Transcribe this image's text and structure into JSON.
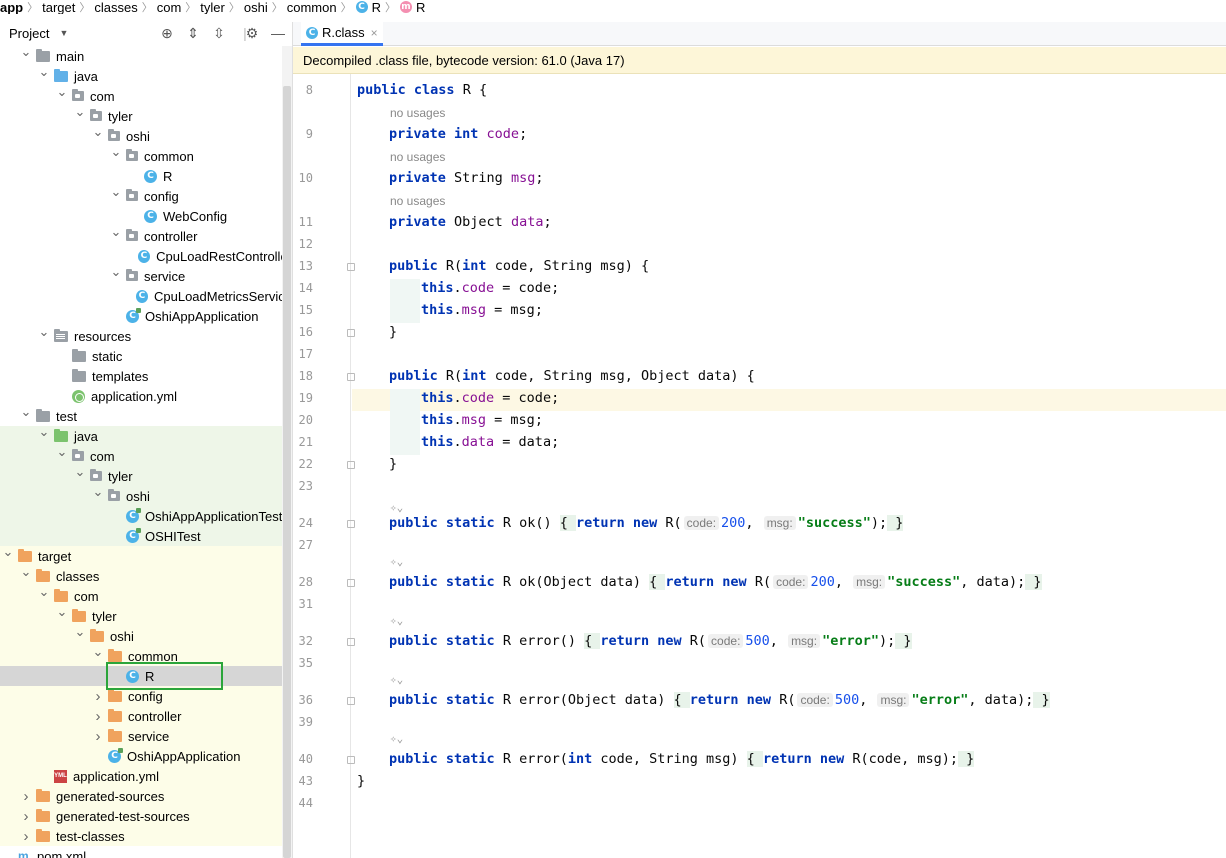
{
  "breadcrumb": {
    "items": [
      "app",
      "target",
      "classes",
      "com",
      "tyler",
      "oshi",
      "common",
      "R",
      "R"
    ]
  },
  "project_panel": {
    "title": "Project",
    "dropdown_icon": "caret-down-icon"
  },
  "tree": [
    {
      "label": "main",
      "type": "folder-gray",
      "depth": 2,
      "arrow": "down"
    },
    {
      "label": "java",
      "type": "folder-blue",
      "depth": 3,
      "arrow": "down"
    },
    {
      "label": "com",
      "type": "package",
      "depth": 4,
      "arrow": "down"
    },
    {
      "label": "tyler",
      "type": "package",
      "depth": 5,
      "arrow": "down"
    },
    {
      "label": "oshi",
      "type": "package",
      "depth": 6,
      "arrow": "down"
    },
    {
      "label": "common",
      "type": "package",
      "depth": 7,
      "arrow": "down"
    },
    {
      "label": "R",
      "type": "class",
      "depth": 8,
      "arrow": ""
    },
    {
      "label": "config",
      "type": "package",
      "depth": 7,
      "arrow": "down"
    },
    {
      "label": "WebConfig",
      "type": "class",
      "depth": 8,
      "arrow": ""
    },
    {
      "label": "controller",
      "type": "package",
      "depth": 7,
      "arrow": "down"
    },
    {
      "label": "CpuLoadRestController",
      "type": "class",
      "depth": 8,
      "arrow": ""
    },
    {
      "label": "service",
      "type": "package",
      "depth": 7,
      "arrow": "down"
    },
    {
      "label": "CpuLoadMetricsService",
      "type": "class",
      "depth": 8,
      "arrow": ""
    },
    {
      "label": "OshiAppApplication",
      "type": "class-run",
      "depth": 7,
      "arrow": ""
    },
    {
      "label": "resources",
      "type": "folder-res",
      "depth": 3,
      "arrow": "down"
    },
    {
      "label": "static",
      "type": "folder-gray",
      "depth": 4,
      "arrow": ""
    },
    {
      "label": "templates",
      "type": "folder-gray",
      "depth": 4,
      "arrow": ""
    },
    {
      "label": "application.yml",
      "type": "yml",
      "depth": 4,
      "arrow": ""
    },
    {
      "label": "test",
      "type": "folder-gray",
      "depth": 2,
      "arrow": "down"
    },
    {
      "label": "java",
      "type": "folder-green",
      "depth": 3,
      "arrow": "down",
      "bg": "green"
    },
    {
      "label": "com",
      "type": "package",
      "depth": 4,
      "arrow": "down",
      "bg": "green"
    },
    {
      "label": "tyler",
      "type": "package",
      "depth": 5,
      "arrow": "down",
      "bg": "green"
    },
    {
      "label": "oshi",
      "type": "package",
      "depth": 6,
      "arrow": "down",
      "bg": "green"
    },
    {
      "label": "OshiAppApplicationTests",
      "type": "class-run",
      "depth": 7,
      "arrow": "",
      "bg": "green"
    },
    {
      "label": "OSHITest",
      "type": "class-run",
      "depth": 7,
      "arrow": "",
      "bg": "green"
    },
    {
      "label": "target",
      "type": "folder-orange",
      "depth": 1,
      "arrow": "down",
      "bg": "yellow"
    },
    {
      "label": "classes",
      "type": "folder-orange",
      "depth": 2,
      "arrow": "down",
      "bg": "yellow"
    },
    {
      "label": "com",
      "type": "folder-orange",
      "depth": 3,
      "arrow": "down",
      "bg": "yellow"
    },
    {
      "label": "tyler",
      "type": "folder-orange",
      "depth": 4,
      "arrow": "down",
      "bg": "yellow"
    },
    {
      "label": "oshi",
      "type": "folder-orange",
      "depth": 5,
      "arrow": "down",
      "bg": "yellow"
    },
    {
      "label": "common",
      "type": "folder-orange",
      "depth": 6,
      "arrow": "down",
      "bg": "yellow"
    },
    {
      "label": "R",
      "type": "class",
      "depth": 7,
      "arrow": "",
      "bg": "selected"
    },
    {
      "label": "config",
      "type": "folder-orange",
      "depth": 6,
      "arrow": "right",
      "bg": "yellow"
    },
    {
      "label": "controller",
      "type": "folder-orange",
      "depth": 6,
      "arrow": "right",
      "bg": "yellow"
    },
    {
      "label": "service",
      "type": "folder-orange",
      "depth": 6,
      "arrow": "right",
      "bg": "yellow"
    },
    {
      "label": "OshiAppApplication",
      "type": "class-run",
      "depth": 6,
      "arrow": "",
      "bg": "yellow"
    },
    {
      "label": "application.yml",
      "type": "yml-file",
      "depth": 3,
      "arrow": "",
      "bg": "yellow"
    },
    {
      "label": "generated-sources",
      "type": "folder-orange",
      "depth": 2,
      "arrow": "right",
      "bg": "yellow"
    },
    {
      "label": "generated-test-sources",
      "type": "folder-orange",
      "depth": 2,
      "arrow": "right",
      "bg": "yellow"
    },
    {
      "label": "test-classes",
      "type": "folder-orange",
      "depth": 2,
      "arrow": "right",
      "bg": "yellow"
    },
    {
      "label": "pom.xml",
      "type": "maven",
      "depth": 1,
      "arrow": ""
    }
  ],
  "editor": {
    "tab": {
      "label": "R.class",
      "icon": "class-icon",
      "close": "×"
    },
    "banner": "Decompiled .class file, bytecode version: 61.0 (Java 17)",
    "usage_hint": "no usages",
    "lines": [
      {
        "n": "8",
        "tokens": [
          [
            "kw",
            "public "
          ],
          [
            "kw",
            "class "
          ],
          [
            "p",
            "R {"
          ]
        ]
      },
      {
        "usage": true
      },
      {
        "n": "9",
        "tokens": [
          [
            "i1",
            ""
          ],
          [
            "kw",
            "private "
          ],
          [
            "kw",
            "int "
          ],
          [
            "fld",
            "code"
          ],
          [
            "p",
            ";"
          ]
        ]
      },
      {
        "usage": true
      },
      {
        "n": "10",
        "tokens": [
          [
            "i1",
            ""
          ],
          [
            "kw",
            "private "
          ],
          [
            "p",
            "String "
          ],
          [
            "fld",
            "msg"
          ],
          [
            "p",
            ";"
          ]
        ]
      },
      {
        "usage": true
      },
      {
        "n": "11",
        "tokens": [
          [
            "i1",
            ""
          ],
          [
            "kw",
            "private "
          ],
          [
            "p",
            "Object "
          ],
          [
            "fld",
            "data"
          ],
          [
            "p",
            ";"
          ]
        ]
      },
      {
        "n": "12",
        "tokens": []
      },
      {
        "n": "13",
        "fold": true,
        "tokens": [
          [
            "i1",
            ""
          ],
          [
            "kw",
            "public "
          ],
          [
            "p",
            "R("
          ],
          [
            "kw",
            "int "
          ],
          [
            "p",
            "code, String msg) {"
          ]
        ]
      },
      {
        "n": "14",
        "ind": true,
        "tokens": [
          [
            "i2",
            ""
          ],
          [
            "kw",
            "this"
          ],
          [
            "p",
            "."
          ],
          [
            "fld",
            "code"
          ],
          [
            "p",
            " = code;"
          ]
        ]
      },
      {
        "n": "15",
        "ind": true,
        "tokens": [
          [
            "i2",
            ""
          ],
          [
            "kw",
            "this"
          ],
          [
            "p",
            "."
          ],
          [
            "fld",
            "msg"
          ],
          [
            "p",
            " = msg;"
          ]
        ]
      },
      {
        "n": "16",
        "fold": true,
        "tokens": [
          [
            "i1",
            ""
          ],
          [
            "p",
            "}"
          ]
        ]
      },
      {
        "n": "17",
        "tokens": []
      },
      {
        "n": "18",
        "fold": true,
        "tokens": [
          [
            "i1",
            ""
          ],
          [
            "kw",
            "public "
          ],
          [
            "p",
            "R("
          ],
          [
            "kw",
            "int "
          ],
          [
            "p",
            "code, String msg, Object data) {"
          ]
        ]
      },
      {
        "n": "19",
        "ind": true,
        "current": true,
        "tokens": [
          [
            "i2",
            ""
          ],
          [
            "kw",
            "this"
          ],
          [
            "p",
            "."
          ],
          [
            "fld",
            "code"
          ],
          [
            "p",
            " = code;"
          ]
        ]
      },
      {
        "n": "20",
        "ind": true,
        "tokens": [
          [
            "i2",
            ""
          ],
          [
            "kw",
            "this"
          ],
          [
            "p",
            "."
          ],
          [
            "fld",
            "msg"
          ],
          [
            "p",
            " = msg;"
          ]
        ]
      },
      {
        "n": "21",
        "ind": true,
        "tokens": [
          [
            "i2",
            ""
          ],
          [
            "kw",
            "this"
          ],
          [
            "p",
            "."
          ],
          [
            "fld",
            "data"
          ],
          [
            "p",
            " = data;"
          ]
        ]
      },
      {
        "n": "22",
        "fold": true,
        "tokens": [
          [
            "i1",
            ""
          ],
          [
            "p",
            "}"
          ]
        ]
      },
      {
        "n": "23",
        "tokens": []
      },
      {
        "annot": true
      },
      {
        "n": "24",
        "fold": true,
        "tokens": [
          [
            "i1",
            ""
          ],
          [
            "kw",
            "public "
          ],
          [
            "kw",
            "static "
          ],
          [
            "p",
            "R ok() "
          ],
          [
            "brc",
            "{ "
          ],
          [
            "kw",
            "return "
          ],
          [
            "kw",
            "new "
          ],
          [
            "p",
            "R("
          ],
          [
            "hint",
            "code:"
          ],
          [
            "num",
            "200"
          ],
          [
            "p",
            ", "
          ],
          [
            "hint",
            "msg:"
          ],
          [
            "str",
            "\"success\""
          ],
          [
            "p",
            ");"
          ],
          [
            "brc",
            " }"
          ]
        ]
      },
      {
        "n": "27",
        "tokens": []
      },
      {
        "annot": true
      },
      {
        "n": "28",
        "fold": true,
        "tokens": [
          [
            "i1",
            ""
          ],
          [
            "kw",
            "public "
          ],
          [
            "kw",
            "static "
          ],
          [
            "p",
            "R ok(Object data) "
          ],
          [
            "brc",
            "{ "
          ],
          [
            "kw",
            "return "
          ],
          [
            "kw",
            "new "
          ],
          [
            "p",
            "R("
          ],
          [
            "hint",
            "code:"
          ],
          [
            "num",
            "200"
          ],
          [
            "p",
            ", "
          ],
          [
            "hint",
            "msg:"
          ],
          [
            "str",
            "\"success\""
          ],
          [
            "p",
            ", data);"
          ],
          [
            "brc",
            " }"
          ]
        ]
      },
      {
        "n": "31",
        "tokens": []
      },
      {
        "annot": true
      },
      {
        "n": "32",
        "fold": true,
        "tokens": [
          [
            "i1",
            ""
          ],
          [
            "kw",
            "public "
          ],
          [
            "kw",
            "static "
          ],
          [
            "p",
            "R error() "
          ],
          [
            "brc",
            "{ "
          ],
          [
            "kw",
            "return "
          ],
          [
            "kw",
            "new "
          ],
          [
            "p",
            "R("
          ],
          [
            "hint",
            "code:"
          ],
          [
            "num",
            "500"
          ],
          [
            "p",
            ", "
          ],
          [
            "hint",
            "msg:"
          ],
          [
            "str",
            "\"error\""
          ],
          [
            "p",
            ");"
          ],
          [
            "brc",
            " }"
          ]
        ]
      },
      {
        "n": "35",
        "tokens": []
      },
      {
        "annot": true
      },
      {
        "n": "36",
        "fold": true,
        "tokens": [
          [
            "i1",
            ""
          ],
          [
            "kw",
            "public "
          ],
          [
            "kw",
            "static "
          ],
          [
            "p",
            "R error(Object data) "
          ],
          [
            "brc",
            "{ "
          ],
          [
            "kw",
            "return "
          ],
          [
            "kw",
            "new "
          ],
          [
            "p",
            "R("
          ],
          [
            "hint",
            "code:"
          ],
          [
            "num",
            "500"
          ],
          [
            "p",
            ", "
          ],
          [
            "hint",
            "msg:"
          ],
          [
            "str",
            "\"error\""
          ],
          [
            "p",
            ", data);"
          ],
          [
            "brc",
            " }"
          ]
        ]
      },
      {
        "n": "39",
        "tokens": []
      },
      {
        "annot": true
      },
      {
        "n": "40",
        "fold": true,
        "tokens": [
          [
            "i1",
            ""
          ],
          [
            "kw",
            "public "
          ],
          [
            "kw",
            "static "
          ],
          [
            "p",
            "R error("
          ],
          [
            "kw",
            "int "
          ],
          [
            "p",
            "code, String msg) "
          ],
          [
            "brc",
            "{ "
          ],
          [
            "kw",
            "return "
          ],
          [
            "kw",
            "new "
          ],
          [
            "p",
            "R(code, msg);"
          ],
          [
            "brc",
            " }"
          ]
        ]
      },
      {
        "n": "43",
        "tokens": [
          [
            "p",
            "}"
          ]
        ]
      },
      {
        "n": "44",
        "tokens": []
      }
    ]
  },
  "colors": {
    "accent": "#3574f0",
    "selection_box": "#2ba53a",
    "banner_bg": "#fdf6d8",
    "target_bg": "#fdfde8",
    "test_bg": "#eef6e8"
  }
}
